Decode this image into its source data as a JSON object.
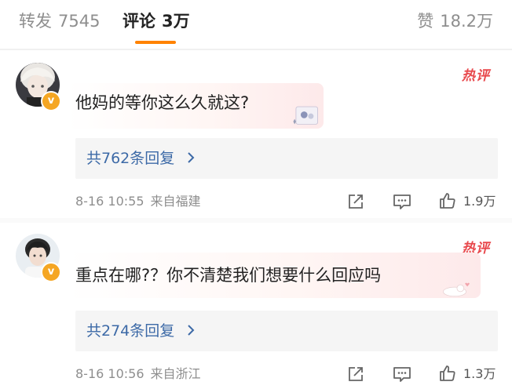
{
  "tabs": {
    "repost_label": "转发",
    "repost_count": "7545",
    "comments_label": "评论",
    "comments_count": "3万",
    "likes_label": "赞",
    "likes_count": "18.2万"
  },
  "colors": {
    "accent": "#ff8200",
    "link": "#3d6aa7",
    "hot": "#e8484c",
    "verified": "#f5a623"
  },
  "comments": [
    {
      "hot_badge": "热评",
      "text": "他妈的等你这么久就这?",
      "replies": "共762条回复",
      "time": "8-16 10:55",
      "location": "来自福建",
      "like_count": "1.9万",
      "avatar_icon": "avatar-blonde",
      "verified_icon": "verified-badge-icon"
    },
    {
      "hot_badge": "热评",
      "text": "重点在哪?？你不清楚我们想要什么回应吗",
      "replies": "共274条回复",
      "time": "8-16 10:56",
      "location": "来自浙江",
      "like_count": "1.3万",
      "avatar_icon": "avatar-person",
      "verified_icon": "verified-badge-icon"
    }
  ]
}
